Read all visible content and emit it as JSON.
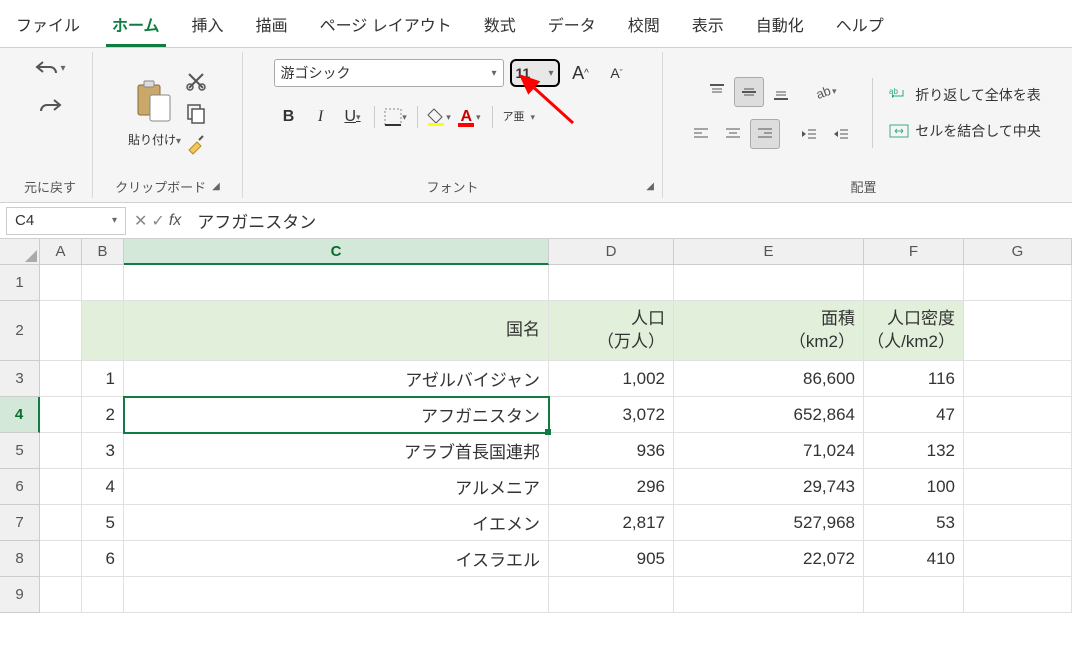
{
  "tabs": [
    "ファイル",
    "ホーム",
    "挿入",
    "描画",
    "ページ レイアウト",
    "数式",
    "データ",
    "校閲",
    "表示",
    "自動化",
    "ヘルプ"
  ],
  "active_tab": 1,
  "ribbon": {
    "undo_group": "元に戻す",
    "clipboard": {
      "paste": "貼り付け",
      "label": "クリップボード"
    },
    "font": {
      "name": "游ゴシック",
      "size": "11",
      "label": "フォント",
      "bold": "B",
      "italic": "I",
      "underline": "U",
      "ruby": "ア亜"
    },
    "alignment": {
      "label": "配置",
      "wrap": "折り返して全体を表",
      "merge": "セルを結合して中央"
    }
  },
  "formula_bar": {
    "cell_ref": "C4",
    "value": "アフガニスタン"
  },
  "columns": [
    "A",
    "B",
    "C",
    "D",
    "E",
    "F",
    "G"
  ],
  "selected_col": 2,
  "selected_row": 3,
  "headers": {
    "c": "国名",
    "d": "人口\n（万人）",
    "e": "面積\n（km2）",
    "f": "人口密度\n（人/km2）"
  },
  "rows": [
    {
      "n": "1",
      "b": "1",
      "c": "アゼルバイジャン",
      "d": "1,002",
      "e": "86,600",
      "f": "116"
    },
    {
      "n": "2",
      "b": "2",
      "c": "アフガニスタン",
      "d": "3,072",
      "e": "652,864",
      "f": "47"
    },
    {
      "n": "3",
      "b": "3",
      "c": "アラブ首長国連邦",
      "d": "936",
      "e": "71,024",
      "f": "132"
    },
    {
      "n": "4",
      "b": "4",
      "c": "アルメニア",
      "d": "296",
      "e": "29,743",
      "f": "100"
    },
    {
      "n": "5",
      "b": "5",
      "c": "イエメン",
      "d": "2,817",
      "e": "527,968",
      "f": "53"
    },
    {
      "n": "6",
      "b": "6",
      "c": "イスラエル",
      "d": "905",
      "e": "22,072",
      "f": "410"
    }
  ]
}
